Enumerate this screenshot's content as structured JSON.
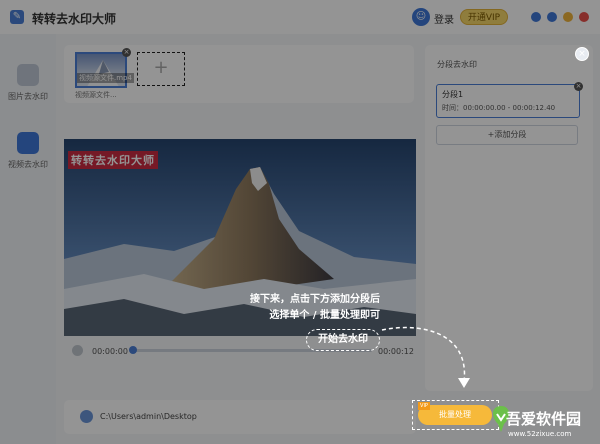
{
  "app": {
    "title": "转转去水印大师",
    "logo_glyph": "✎",
    "login": "登录",
    "vip_button": "开通VIP",
    "avatar_glyph": "☺"
  },
  "window_buttons": [
    {
      "name": "skin",
      "color": "#3f78d8"
    },
    {
      "name": "menu",
      "color": "#3f78d8"
    },
    {
      "name": "minimize",
      "color": "#f0b43c"
    },
    {
      "name": "close",
      "color": "#e8504a"
    }
  ],
  "sidebar": {
    "items": [
      {
        "label": "图片去水印",
        "color": "#bfc9d6"
      },
      {
        "label": "视频去水印",
        "color": "#3f78d8"
      }
    ]
  },
  "files": {
    "thumb_name": "视频源文件.mp4",
    "caption": "视频源文件...",
    "close_glyph": "×",
    "add_glyph": "+"
  },
  "video": {
    "watermark_text": "转转去水印大师",
    "time_start": "00:00:00",
    "time_end": "00:00:12",
    "progress": 0
  },
  "right_panel": {
    "title": "分段去水印",
    "close_glyph": "×",
    "segment_name": "分段1",
    "segment_time": "时间：00:00:00.00 - 00:00:12.40",
    "segment_close_glyph": "×",
    "add_segment": "+添加分段"
  },
  "bottom": {
    "path": "C:\\Users\\admin\\Desktop",
    "batch_button": "批量处理",
    "vip_tag": "VIP"
  },
  "tooltip": {
    "line1": "接下来，点击下方添加分段后",
    "line2": "选择单个 / 批量处理即可",
    "start_button": "开始去水印"
  },
  "site": {
    "name": "吾爱软件园",
    "url": "www.52zixue.com"
  }
}
